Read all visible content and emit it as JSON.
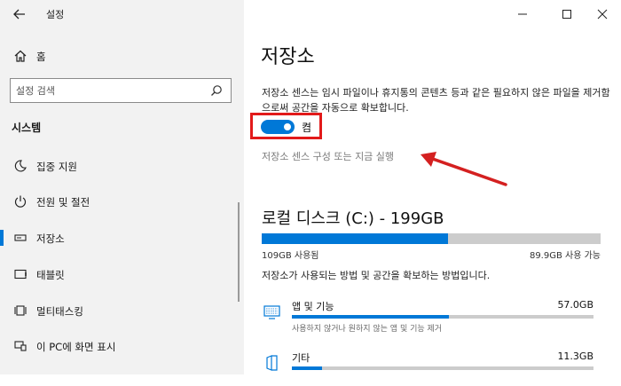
{
  "window": {
    "title": "설정"
  },
  "sidebar": {
    "home_label": "홈",
    "search_placeholder": "설정 검색",
    "section_heading": "시스템",
    "items": [
      {
        "label": "집중 지원",
        "icon": "moon-icon"
      },
      {
        "label": "전원 및 절전",
        "icon": "power-icon"
      },
      {
        "label": "저장소",
        "icon": "storage-icon",
        "selected": true
      },
      {
        "label": "태블릿",
        "icon": "tablet-icon"
      },
      {
        "label": "멀티태스킹",
        "icon": "multitasking-icon"
      },
      {
        "label": "이 PC에 화면 표시",
        "icon": "project-icon"
      }
    ]
  },
  "main": {
    "title": "저장소",
    "description": "저장소 센스는 임시 파일이나 휴지통의 콘텐츠 등과 같은 필요하지 않은 파일을 제거함으로써 공간을 자동으로 확보합니다.",
    "toggle_label": "켬",
    "toggle_on": true,
    "config_link": "저장소 센스 구성 또는 지금 실행",
    "disk": {
      "title": "로컬 디스크 (C:) - 199GB",
      "used_label": "109GB 사용됨",
      "free_label": "89.9GB 사용 가능",
      "used_fraction": 0.55
    },
    "usage_description": "저장소가 사용되는 방법 및 공간을 확보하는 방법입니다.",
    "categories": [
      {
        "name": "앱 및 기능",
        "size": "57.0GB",
        "subtitle": "사용하지 않거나 원하지 않는 앱 및 기능 제거",
        "fraction": 0.52,
        "icon": "apps-icon"
      },
      {
        "name": "기타",
        "size": "11.3GB",
        "subtitle": "",
        "fraction": 0.1,
        "icon": "other-files-icon"
      }
    ]
  },
  "colors": {
    "accent": "#0078d7",
    "highlight": "#e21a1a"
  }
}
